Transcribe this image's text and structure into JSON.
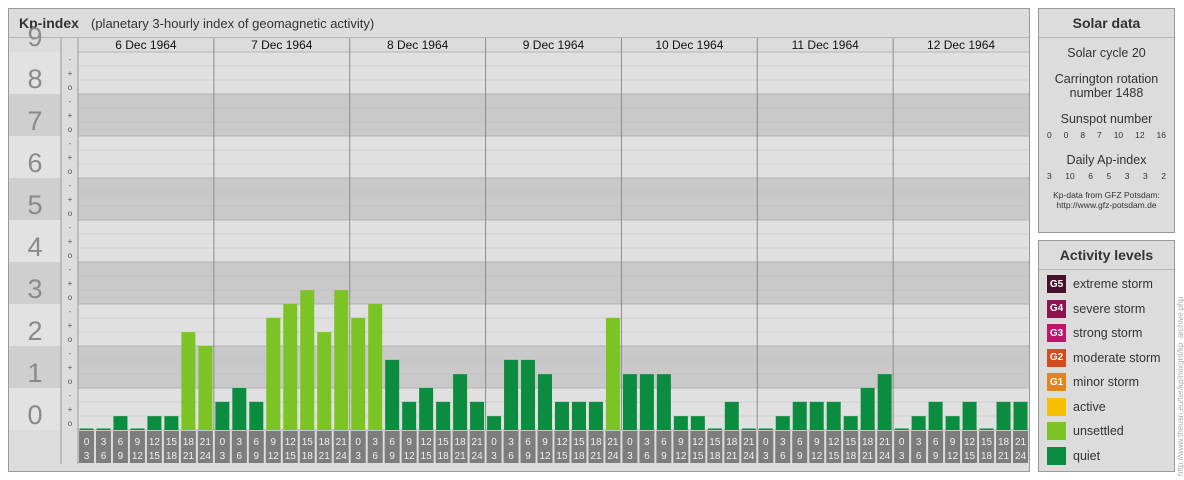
{
  "header": {
    "title": "Kp-index",
    "subtitle": "(planetary 3-hourly index of geomagnetic activity)"
  },
  "chart_data": {
    "type": "bar",
    "title": "Kp-index",
    "y_range": [
      0,
      9
    ],
    "y_ticks": [
      "0",
      "1",
      "2",
      "3",
      "4",
      "5",
      "6",
      "7",
      "8",
      "9"
    ],
    "minor_tick_labels": [
      "o",
      "+",
      "-"
    ],
    "days": [
      "6 Dec 1964",
      "7 Dec 1964",
      "8 Dec 1964",
      "9 Dec 1964",
      "10 Dec 1964",
      "11 Dec 1964",
      "12 Dec 1964"
    ],
    "interval_start_labels": [
      "0",
      "3",
      "6",
      "9",
      "12",
      "15",
      "18",
      "21"
    ],
    "interval_end_labels": [
      "3",
      "6",
      "9",
      "12",
      "15",
      "18",
      "21",
      "24"
    ],
    "kp_values": [
      [
        0,
        0,
        0.33,
        0,
        0.33,
        0.33,
        2.33,
        2
      ],
      [
        0.67,
        1,
        0.67,
        2.67,
        3,
        3.33,
        2.33,
        3.33
      ],
      [
        2.67,
        3,
        1.67,
        0.67,
        1,
        0.67,
        1.33,
        0.67
      ],
      [
        0.33,
        1.67,
        1.67,
        1.33,
        0.67,
        0.67,
        0.67,
        2.67
      ],
      [
        1.33,
        1.33,
        1.33,
        0.33,
        0.33,
        0,
        0.67,
        0
      ],
      [
        0,
        0.33,
        0.67,
        0.67,
        0.67,
        0.33,
        1,
        1.33
      ],
      [
        0,
        0.33,
        0.67,
        0.33,
        0.67,
        0,
        0.67,
        0.67
      ]
    ],
    "colors": {
      "quiet": "#0b8c3e",
      "unsettled": "#7cc425",
      "band_dark": "#c9c9c9",
      "band_light": "#e0e0e0",
      "time_label_bg": "#7d7d7d"
    }
  },
  "solar": {
    "title": "Solar data",
    "cycle": "Solar cycle 20",
    "carrington_line1": "Carrington rotation",
    "carrington_line2": "number 1488",
    "sunspot_title": "Sunspot number",
    "sunspot_values": [
      "0",
      "0",
      "8",
      "7",
      "10",
      "12",
      "16"
    ],
    "ap_title": "Daily Ap-index",
    "ap_values": [
      "3",
      "10",
      "6",
      "5",
      "3",
      "3",
      "2"
    ],
    "source_line1": "Kp-data from GFZ Potsdam:",
    "source_line2": "http://www.gfz-potsdam.de"
  },
  "activity": {
    "title": "Activity levels",
    "levels": [
      {
        "badge": "G5",
        "label": "extreme storm",
        "color": "#4a0f2c"
      },
      {
        "badge": "G4",
        "label": "severe storm",
        "color": "#8c1450"
      },
      {
        "badge": "G3",
        "label": "strong storm",
        "color": "#c0136a"
      },
      {
        "badge": "G2",
        "label": "moderate storm",
        "color": "#d64a1e"
      },
      {
        "badge": "G1",
        "label": "minor storm",
        "color": "#e38518"
      },
      {
        "badge": "",
        "label": "active",
        "color": "#f6c000"
      },
      {
        "badge": "",
        "label": "unsettled",
        "color": "#7cc425"
      },
      {
        "badge": "",
        "label": "quiet",
        "color": "#0b8c3e"
      }
    ]
  },
  "credit": "http://www.theusn.eu/ter/kp/mixgrd/kp_archive.php"
}
